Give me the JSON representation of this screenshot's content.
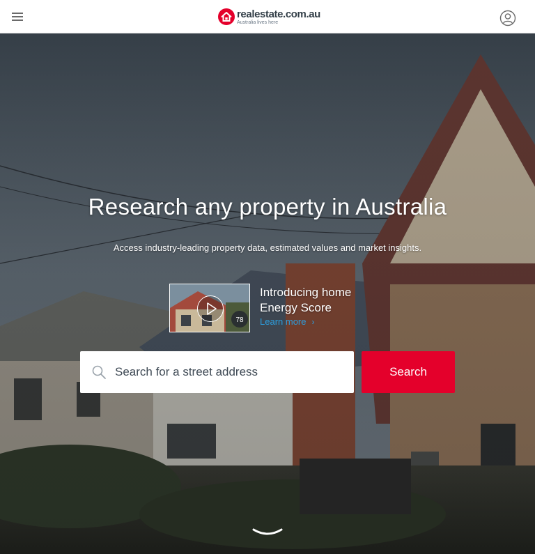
{
  "header": {
    "menu_icon": "hamburger-menu-icon",
    "logo": {
      "wordmark": "realestate.com.au",
      "tagline": "Australia lives here",
      "icon": "house-logo-icon",
      "brand_color": "#e4002b"
    },
    "account_icon": "user-account-icon"
  },
  "hero": {
    "headline": "Research any property in Australia",
    "subheadline": "Access industry-leading property data, estimated values and market insights.",
    "promo": {
      "title": "Introducing home Energy Score",
      "link_label": "Learn more",
      "link_icon": "chevron-right-icon",
      "thumbnail_icon": "play-video-icon",
      "thumbnail_badge": "78",
      "link_color": "#2c9fe0"
    },
    "search": {
      "placeholder": "Search for a street address",
      "value": "",
      "search_icon": "magnifier-icon",
      "button_label": "Search",
      "button_color": "#e4002b"
    },
    "scroll_icon": "chevron-down-icon"
  }
}
